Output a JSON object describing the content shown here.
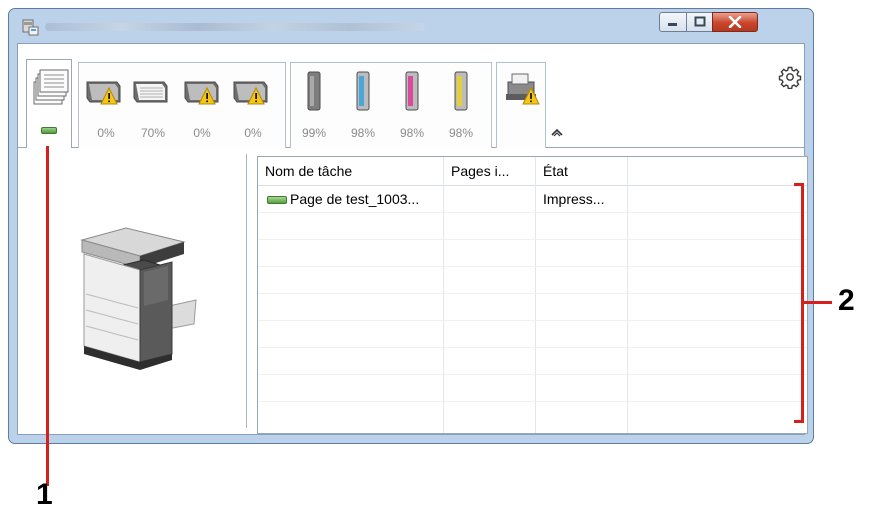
{
  "window": {
    "title": "",
    "controls": {
      "minimize": "minimize",
      "maximize": "maximize",
      "close": "close"
    }
  },
  "toolbar": {
    "trays": [
      {
        "icon": "paper-tray-warning-icon",
        "percent": "0%"
      },
      {
        "icon": "paper-tray-icon",
        "percent": "70%"
      },
      {
        "icon": "paper-tray-warning-icon",
        "percent": "0%"
      },
      {
        "icon": "paper-tray-warning-icon",
        "percent": "0%"
      }
    ],
    "toners": [
      {
        "color": "#7d7d7d",
        "percent": "99%"
      },
      {
        "color": "#4aa6d8",
        "percent": "98%"
      },
      {
        "color": "#d94b9a",
        "percent": "98%"
      },
      {
        "color": "#e3cf3c",
        "percent": "98%"
      }
    ]
  },
  "table": {
    "columns": [
      "Nom de tâche",
      "Pages i...",
      "État"
    ],
    "rows": [
      {
        "name": "Page de test_1003...",
        "pages": "",
        "state": "Impress..."
      }
    ]
  },
  "callouts": {
    "one": "1",
    "two": "2"
  },
  "colors": {
    "accent": "#d6201d",
    "status_ok": "#56a040"
  }
}
